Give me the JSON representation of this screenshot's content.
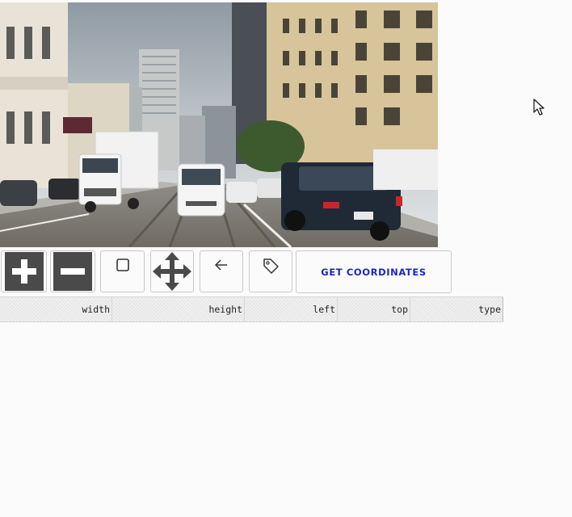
{
  "toolbar": {
    "zoom_in": {
      "icon": "plus-icon"
    },
    "zoom_out": {
      "icon": "minus-icon"
    },
    "draw_box": {
      "icon": "square-icon"
    },
    "move": {
      "icon": "move-arrows-icon"
    },
    "undo": {
      "icon": "arrow-left-icon"
    },
    "label": {
      "icon": "tag-icon"
    },
    "get_coordinates_label": "GET COORDINATES",
    "accent_color": "#1a26c6"
  },
  "table": {
    "columns": [
      "width",
      "height",
      "left",
      "top",
      "type"
    ],
    "rows": []
  },
  "image": {
    "description_icon": "street-photo"
  },
  "pointer": {
    "icon": "mouse-pointer-icon"
  }
}
